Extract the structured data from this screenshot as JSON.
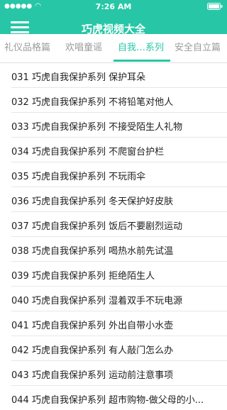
{
  "status_bar": {
    "time": "7:26 AM"
  },
  "header": {
    "title": "巧虎视频大全"
  },
  "tabs": [
    {
      "label": "礼仪品格篇",
      "active": false
    },
    {
      "label": "欢唱童谣",
      "active": false
    },
    {
      "label": "自我…系列",
      "active": true
    },
    {
      "label": "安全自立篇",
      "active": false
    }
  ],
  "list": {
    "items": [
      "031 巧虎自我保护系列 保护耳朵",
      "032 巧虎自我保护系列 不将铅笔对他人",
      "033 巧虎自我保护系列 不接受陌生人礼物",
      "034 巧虎自我保护系列 不爬窗台护栏",
      "035 巧虎自我保护系列 不玩雨伞",
      "036 巧虎自我保护系列 冬天保护好皮肤",
      "037 巧虎自我保护系列 饭后不要剧烈运动",
      "038 巧虎自我保护系列 喝热水前先试温",
      "039 巧虎自我保护系列 拒绝陌生人",
      "040 巧虎自我保护系列 湿着双手不玩电源",
      "041 巧虎自我保护系列 外出自带小水壶",
      "042 巧虎自我保护系列 有人敲门怎么办",
      "043 巧虎自我保护系列 运动前注意事项",
      "044 巧虎自我保护系列 超市购物-做父母的小..."
    ]
  }
}
